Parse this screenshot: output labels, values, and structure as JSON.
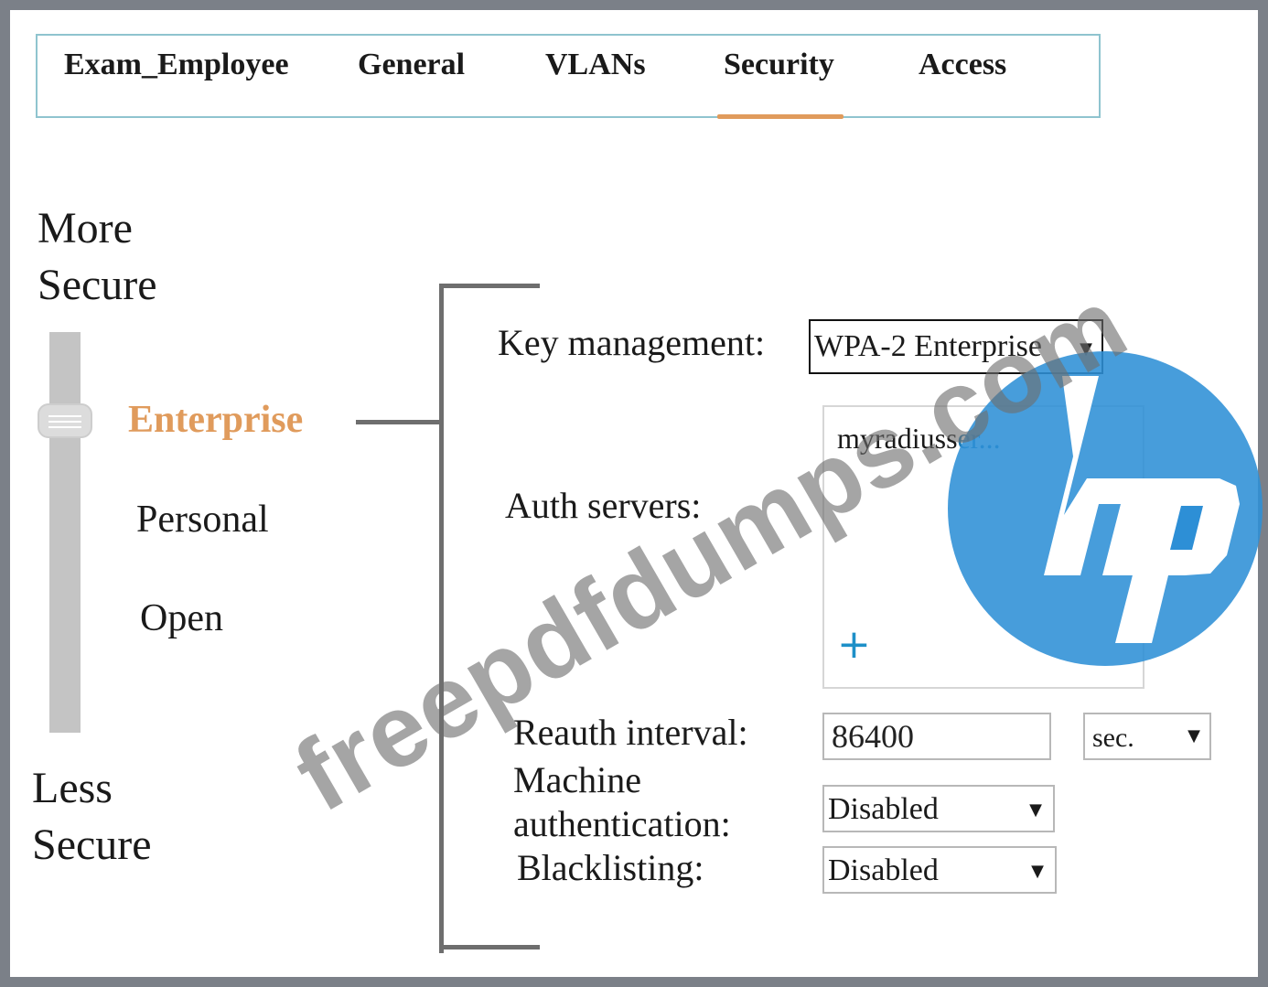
{
  "tabs": [
    {
      "label": "Exam_Employee"
    },
    {
      "label": "General"
    },
    {
      "label": "VLANs"
    },
    {
      "label": "Security",
      "active": true
    },
    {
      "label": "Access"
    }
  ],
  "security_scale": {
    "top_label_line1": "More",
    "top_label_line2": "Secure",
    "bottom_label_line1": "Less",
    "bottom_label_line2": "Secure",
    "levels": [
      "Enterprise",
      "Personal",
      "Open"
    ],
    "selected": "Enterprise"
  },
  "form": {
    "key_management": {
      "label": "Key management:",
      "value": "WPA-2 Enterprise"
    },
    "auth_servers": {
      "label": "Auth servers:",
      "item_main": "myradiuss",
      "item_faded": "er...",
      "add_symbol": "+"
    },
    "reauth_interval": {
      "label": "Reauth interval:",
      "value": "86400",
      "unit": "sec."
    },
    "machine_auth": {
      "label_line1": "Machine",
      "label_line2": "authentication:",
      "value": "Disabled"
    },
    "blacklisting": {
      "label": "Blacklisting:",
      "value": "Disabled"
    }
  },
  "logo": {
    "name": "hp-logo",
    "text": "hp",
    "color": "#2d8fd6"
  },
  "watermark": {
    "text": "freepdfdumps.com"
  },
  "colors": {
    "accent": "#e09b5c",
    "link": "#1d90c8",
    "tabbar_border": "#8fc4cf"
  }
}
